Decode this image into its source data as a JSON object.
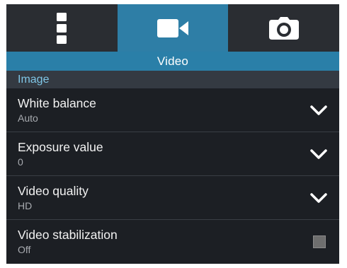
{
  "tabs": [
    {
      "icon": "more-vert-icon",
      "active": false
    },
    {
      "icon": "video-camera-icon",
      "active": true
    },
    {
      "icon": "camera-icon",
      "active": false
    }
  ],
  "section_title": "Video",
  "group_header": "Image",
  "settings": [
    {
      "title": "White balance",
      "value": "Auto",
      "control": "dropdown"
    },
    {
      "title": "Exposure value",
      "value": "0",
      "control": "dropdown"
    },
    {
      "title": "Video quality",
      "value": "HD",
      "control": "dropdown"
    },
    {
      "title": "Video stabilization",
      "value": "Off",
      "control": "checkbox",
      "checked": false
    }
  ],
  "colors": {
    "accent": "#2a7fa8",
    "background": "#1c1f24",
    "group_header_text": "#7fc6e6"
  }
}
